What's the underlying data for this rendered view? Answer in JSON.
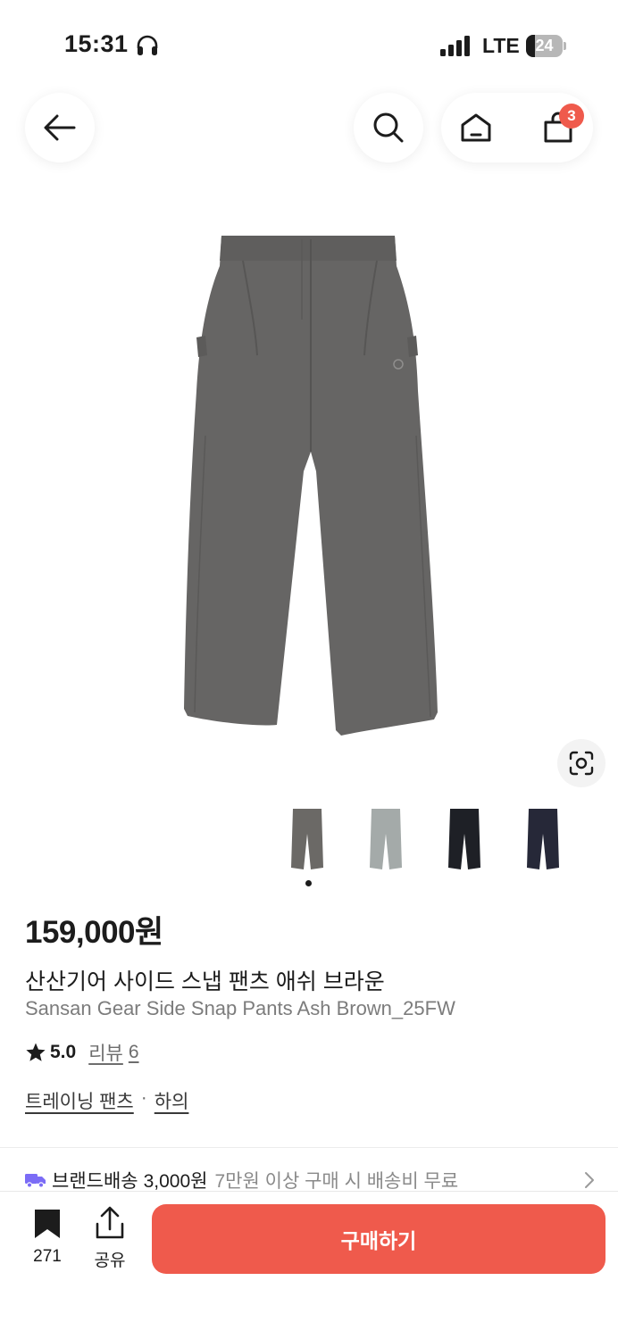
{
  "status_bar": {
    "time": "15:31",
    "network": "LTE",
    "battery": "24",
    "battery_level": 0.24
  },
  "header": {
    "back_icon": "arrow-left-icon",
    "search_icon": "search-icon",
    "home_icon": "home-icon",
    "cart_icon": "shopping-bag-icon",
    "cart_count": "3"
  },
  "product": {
    "image_alt_icon": "pants-image",
    "lens_icon": "visual-search-icon",
    "thumbnails": [
      {
        "color_name": "ash-brown",
        "color": "#6b6966"
      },
      {
        "color_name": "grey",
        "color": "#a4aaa9"
      },
      {
        "color_name": "black",
        "color": "#1e2026"
      },
      {
        "color_name": "navy",
        "color": "#262838"
      }
    ],
    "price": "159,000원",
    "title_ko": "산산기어 사이드 스냅 팬츠 애쉬 브라운",
    "title_en": "Sansan Gear Side Snap Pants Ash Brown_25FW",
    "rating": "5.0",
    "review_label": "리뷰",
    "review_count": "6",
    "category_1": "트레이닝 팬츠",
    "category_sep": "·",
    "category_2": "하의"
  },
  "shipping": {
    "brand_label": "브랜드배송",
    "fee": "3,000원",
    "note": "7만원 이상 구매 시 배송비 무료"
  },
  "bottom_bar": {
    "bookmark_count": "271",
    "share_label": "공유",
    "buy_label": "구매하기"
  },
  "colors": {
    "accent": "#ef5a4c",
    "shipping_truck": "#7b6cf6"
  }
}
